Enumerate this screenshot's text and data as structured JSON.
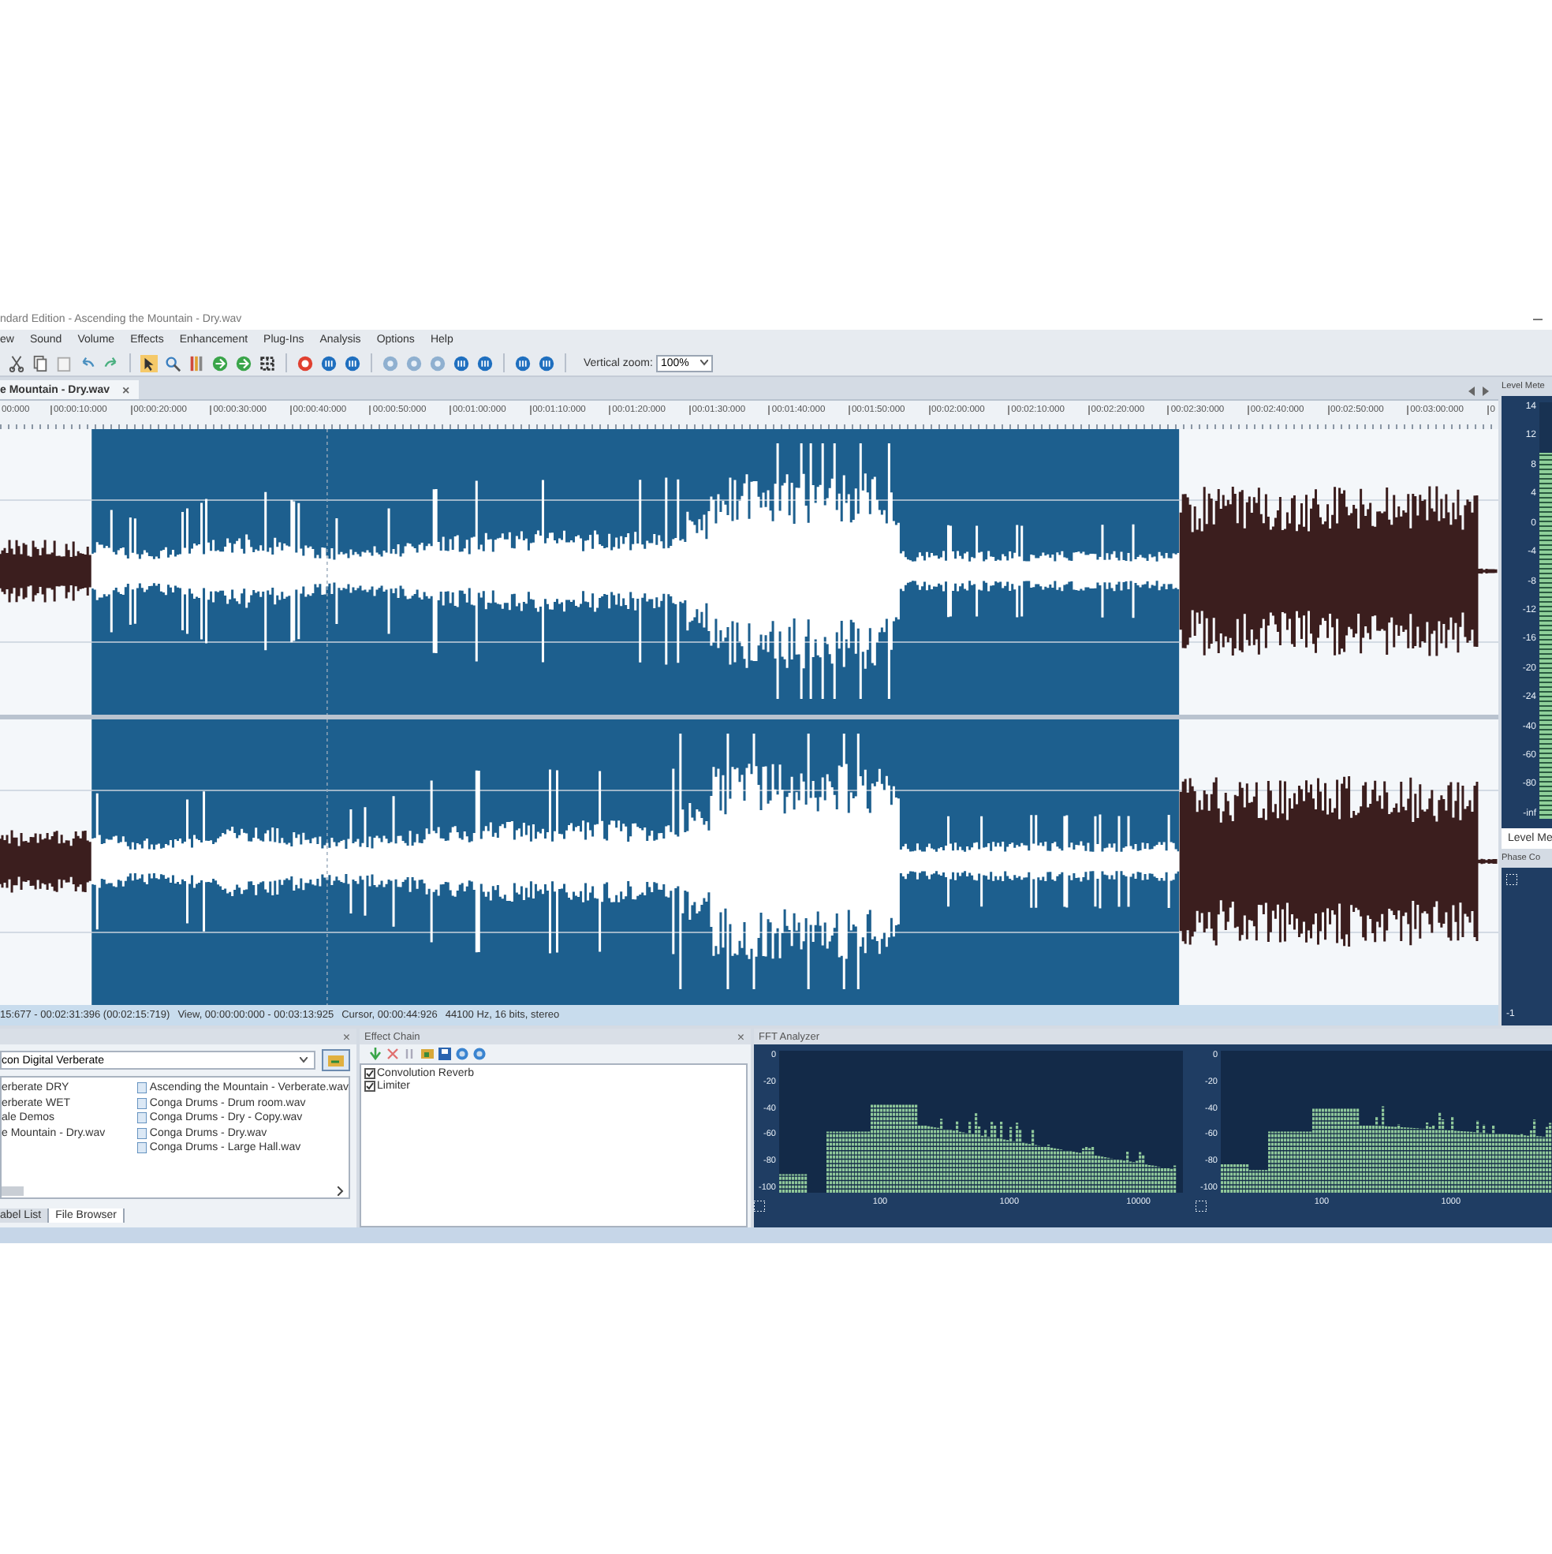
{
  "window": {
    "title": "ndard Edition - Ascending the Mountain - Dry.wav"
  },
  "menu": [
    "ew",
    "Sound",
    "Volume",
    "Effects",
    "Enhancement",
    "Plug-Ins",
    "Analysis",
    "Options",
    "Help"
  ],
  "toolbar": {
    "vertical_zoom_label": "Vertical zoom:",
    "vertical_zoom_value": "100%"
  },
  "document_tab": {
    "label": "e Mountain - Dry.wav",
    "close": "×"
  },
  "timeline": {
    "labels": [
      "00:000",
      "00:00:10:000",
      "00:00:20:000",
      "00:00:30:000",
      "00:00:40:000",
      "00:00:50:000",
      "00:01:00:000",
      "00:01:10:000",
      "00:01:20:000",
      "00:01:30:000",
      "00:01:40:000",
      "00:01:50:000",
      "00:02:00:000",
      "00:02:10:000",
      "00:02:20:000",
      "00:02:30:000",
      "00:02:40:000",
      "00:02:50:000",
      "00:03:00:000",
      "0"
    ]
  },
  "status_bar": [
    "15:677 - 00:02:31:396 (00:02:15:719)",
    "View, 00:00:00:000 - 00:03:13:925",
    "Cursor, 00:00:44:926",
    "44100 Hz, 16 bits, stereo"
  ],
  "level_meter": {
    "title": "Level Mete",
    "ticks": [
      "14",
      "12",
      "8",
      "4",
      "0",
      "-4",
      "-8",
      "-12",
      "-16",
      "-20",
      "-24",
      "-40",
      "-60",
      "-80",
      "-inf"
    ],
    "level": 0.88,
    "tab": "Level Me"
  },
  "phase_panel": {
    "title": "Phase Co",
    "tick": "-1"
  },
  "file_browser": {
    "close": "×",
    "preset": "con Digital Verberate",
    "files_left": [
      "erberate DRY",
      "erberate WET",
      "ale Demos",
      "e Mountain - Dry.wav"
    ],
    "files_right": [
      "Ascending the Mountain - Verberate.wav",
      "Conga Drums - Drum room.wav",
      "Conga Drums - Dry - Copy.wav",
      "Conga Drums - Dry.wav",
      "Conga Drums - Large Hall.wav"
    ],
    "tabs": [
      {
        "label": "abel List",
        "selected": false
      },
      {
        "label": "File Browser",
        "selected": true
      }
    ]
  },
  "effect_chain": {
    "title": "Effect Chain",
    "close": "×",
    "effects": [
      {
        "label": "Convolution Reverb",
        "checked": true
      },
      {
        "label": "Limiter",
        "checked": true
      }
    ]
  },
  "fft_analyzer": {
    "title": "FFT Analyzer",
    "channels": [
      {
        "y_ticks": [
          "0",
          "-20",
          "-40",
          "-60",
          "-80",
          "-100"
        ],
        "x_ticks": [
          "100",
          "1000",
          "10000"
        ]
      },
      {
        "y_ticks": [
          "0",
          "-20",
          "-40",
          "-60",
          "-80",
          "-100"
        ],
        "x_ticks": [
          "100",
          "1000"
        ]
      }
    ]
  }
}
